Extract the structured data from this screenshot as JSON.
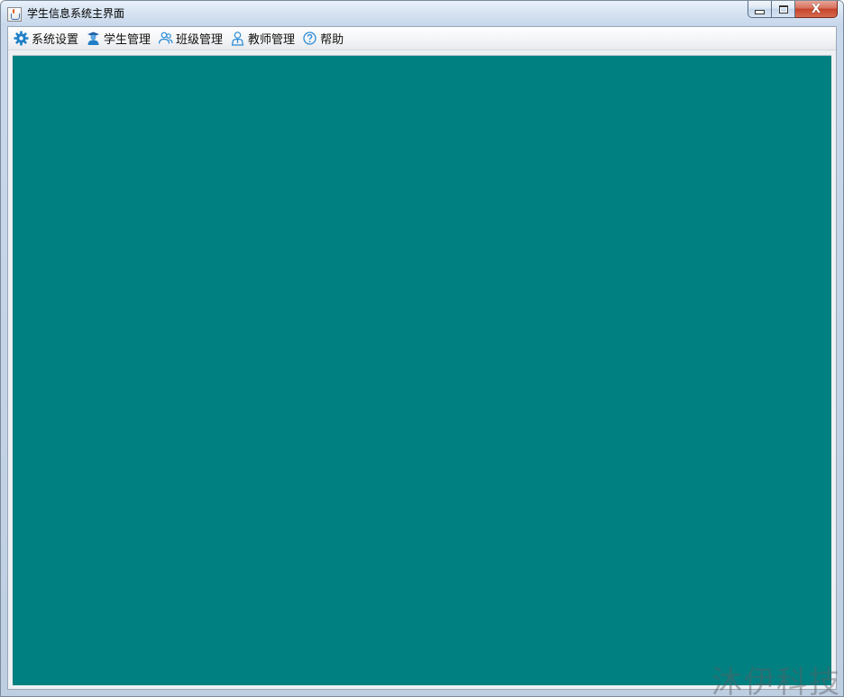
{
  "window": {
    "title": "学生信息系统主界面",
    "close_glyph": "X"
  },
  "menubar": {
    "items": [
      {
        "label": "系统设置",
        "icon": "gear-icon"
      },
      {
        "label": "学生管理",
        "icon": "student-icon"
      },
      {
        "label": "班级管理",
        "icon": "class-group-icon"
      },
      {
        "label": "教师管理",
        "icon": "teacher-icon"
      },
      {
        "label": "帮助",
        "icon": "help-icon"
      }
    ]
  },
  "desktop": {
    "background_color": "#008080"
  },
  "watermark": {
    "text": "沐伊科技"
  },
  "colors": {
    "accent": "#1e7fc8",
    "desktop": "#008080"
  }
}
